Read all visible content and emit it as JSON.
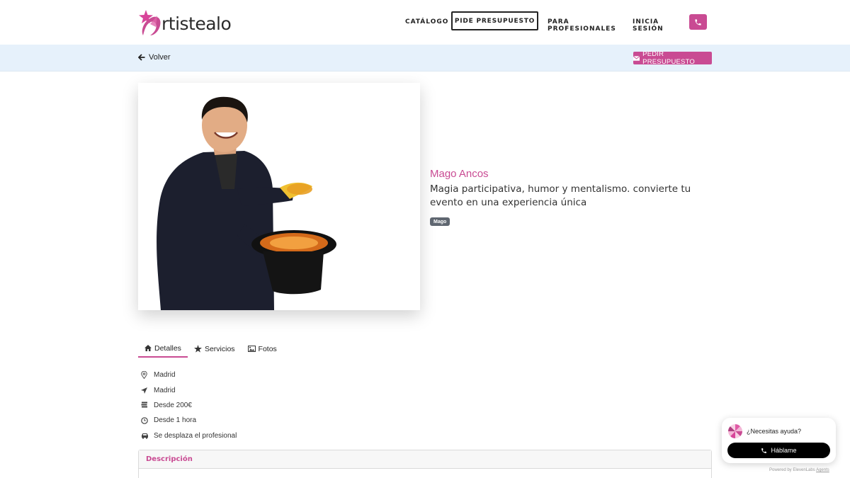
{
  "header": {
    "logo_text": "rtistealo",
    "nav": {
      "catalogo": "CATÁLOGO",
      "pide_presupuesto": "PIDE PRESUPUESTO",
      "para_profesionales": "PARA PROFESIONALES",
      "inicia_sesion": "INICIA SESIÓN"
    },
    "phone_icon": "phone-icon"
  },
  "subbar": {
    "back_label": "Volver",
    "request_label": "PEDIR PRESUPUESTO"
  },
  "artist": {
    "name": "Mago Ancos",
    "description": "Magia participativa, humor y mentalismo. convierte tu evento en una experiencia única",
    "tag": "Mago"
  },
  "tabs": [
    {
      "label": "Detalles",
      "icon": "home-icon",
      "active": true
    },
    {
      "label": "Servicios",
      "icon": "star-icon",
      "active": false
    },
    {
      "label": "Fotos",
      "icon": "image-icon",
      "active": false
    }
  ],
  "details": [
    {
      "icon": "map-pin-icon",
      "text": "Madrid"
    },
    {
      "icon": "location-arrow-icon",
      "text": "Madrid"
    },
    {
      "icon": "money-icon",
      "text": "Desde 200€"
    },
    {
      "icon": "clock-icon",
      "text": "Desde 1 hora"
    },
    {
      "icon": "car-icon",
      "text": "Se desplaza el profesional"
    }
  ],
  "description_panel": {
    "title": "Descripción"
  },
  "help_widget": {
    "question": "¿Necesitas ayuda?",
    "button": "Háblame",
    "powered_prefix": "Powered by ElevenLabs",
    "powered_link": "Agents"
  },
  "colors": {
    "brand": "#c94b93",
    "subbar_bg": "#e6f1fb",
    "tag_bg": "#5f6670"
  }
}
